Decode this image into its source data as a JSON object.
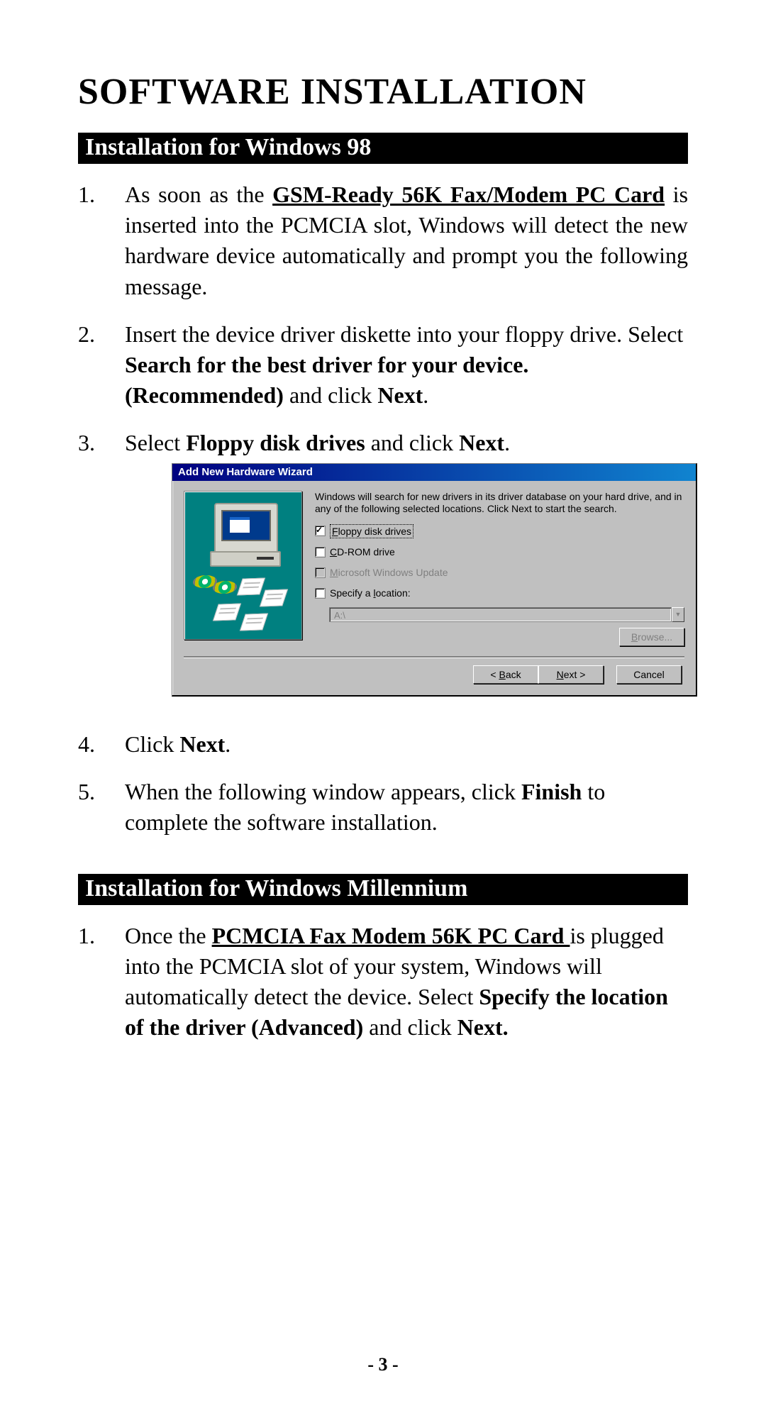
{
  "title": "SOFTWARE INSTALLATION",
  "page_number": "- 3 -",
  "section1": {
    "header": "Installation for Windows 98",
    "step1_a": "As soon as the ",
    "step1_prod": "GSM-Ready 56K Fax/Modem PC Card",
    "step1_b": " is inserted into the PCMCIA slot, Windows will detect the new hardware device automatically and prompt you the following message.",
    "step2_a": "Insert the device driver diskette into your floppy drive. Select ",
    "step2_bold": "Search for the best driver for your device. (Recommended)",
    "step2_b": " and click ",
    "step2_next": "Next",
    "step2_c": ".",
    "step3_a": "Select ",
    "step3_bold": "Floppy disk drives",
    "step3_b": " and click ",
    "step3_next": "Next",
    "step3_c": ".",
    "step4_a": "Click ",
    "step4_next": "Next",
    "step4_b": ".",
    "step5_a": "When the following window appears, click ",
    "step5_bold": "Finish",
    "step5_b": " to complete the software installation."
  },
  "wizard": {
    "title": "Add New Hardware Wizard",
    "instructions": "Windows will search for new drivers in its driver database on your hard drive, and in any of the following selected locations. Click Next to start the search.",
    "opts": {
      "floppy_pre": "F",
      "floppy_rest": "loppy disk drives",
      "cd_pre": "C",
      "cd_rest": "D-ROM drive",
      "mwu_pre": "M",
      "mwu_rest": "icrosoft Windows Update",
      "loc_pre": "Specify a ",
      "loc_mn": "l",
      "loc_rest": "ocation:"
    },
    "path_value": "A:\\",
    "browse_pre": "B",
    "browse_rest": "rowse...",
    "back_label": "< ",
    "back_mn": "B",
    "back_rest": "ack",
    "next_label_pre": "N",
    "next_label_rest": "ext >",
    "cancel_label": "Cancel"
  },
  "section2": {
    "header": "Installation for Windows Millennium",
    "step1_a": "Once the ",
    "step1_prod": "PCMCIA Fax Modem 56K PC Card ",
    "step1_b": "is plugged into the PCMCIA slot of your system, Windows will automatically detect the device.  Select ",
    "step1_bold": "Specify the location of the driver (Advanced)",
    "step1_c": " and click ",
    "step1_next": "Next."
  }
}
